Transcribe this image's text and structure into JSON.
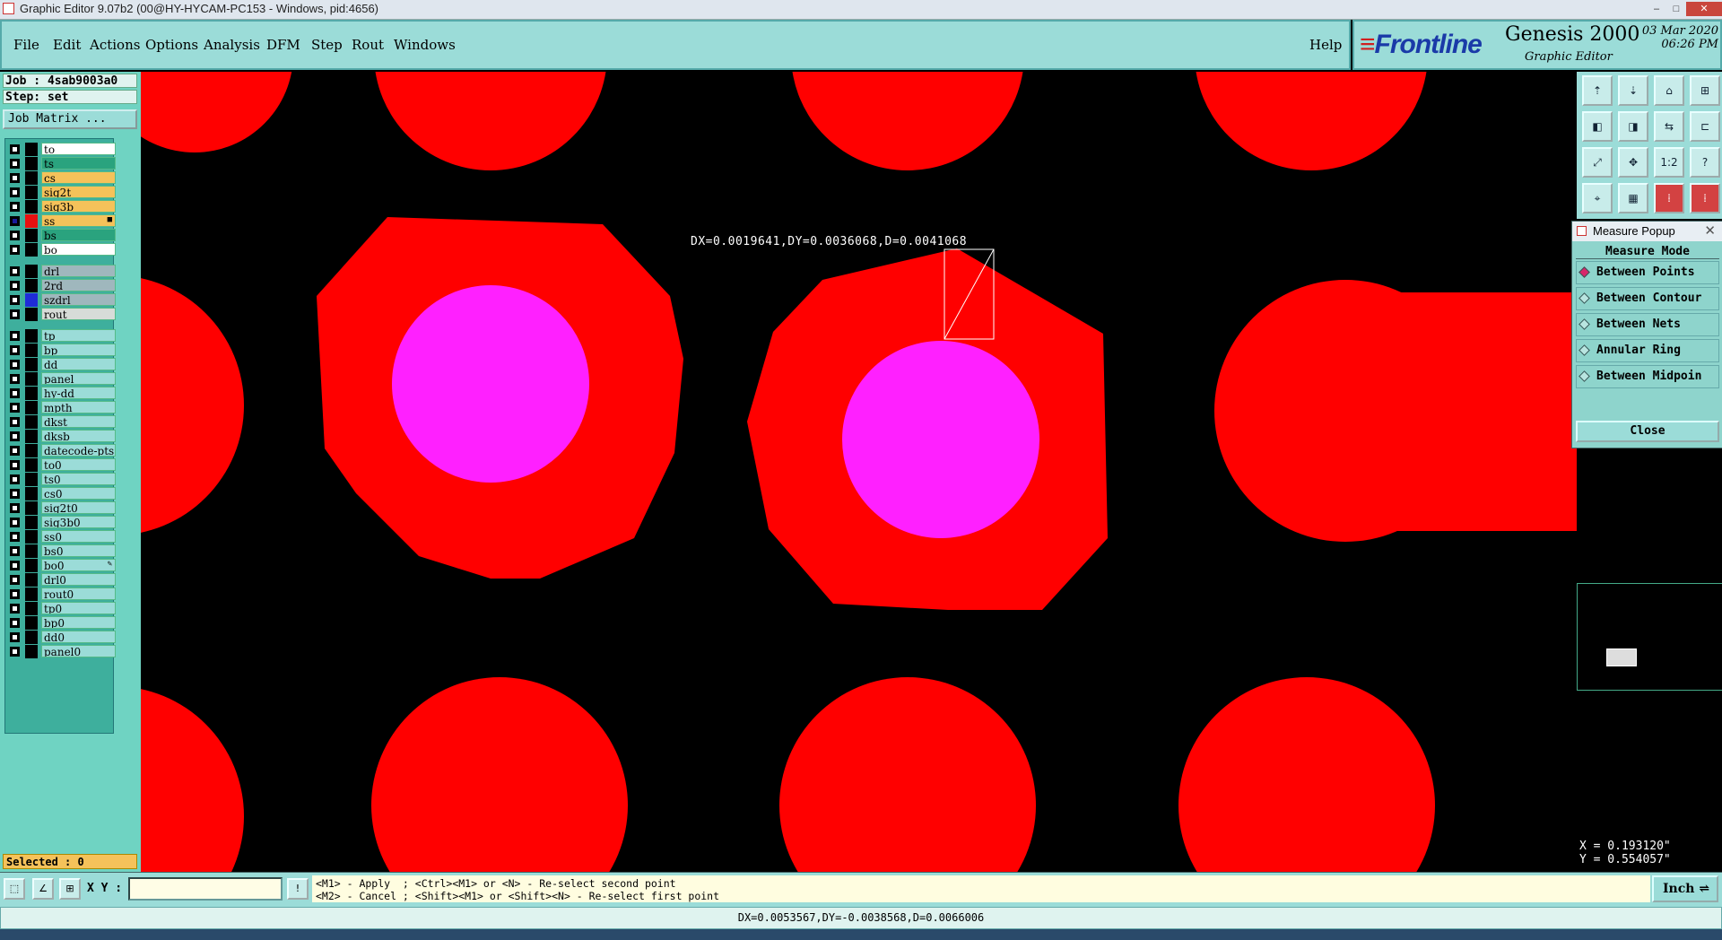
{
  "window": {
    "title": "Graphic Editor 9.07b2 (00@HY-HYCAM-PC153 - Windows, pid:4656)",
    "minimize": "–",
    "maximize": "□",
    "close": "✕"
  },
  "menu": {
    "items": [
      "File",
      "Edit",
      "Actions",
      "Options",
      "Analysis",
      "DFM",
      "Step",
      "Rout",
      "Windows"
    ],
    "help": "Help"
  },
  "brand": {
    "logo": "Frontline",
    "product": "Genesis 2000",
    "subtitle": "Graphic Editor",
    "date": "03 Mar 2020",
    "time": "06:26 PM"
  },
  "left_panel": {
    "job": "Job : 4sab9003a0",
    "step": "Step: set",
    "job_matrix": "Job Matrix ...",
    "selected": "Selected : 0",
    "layers": [
      {
        "name": "to",
        "color": "#ffffff",
        "swatch": "",
        "checked": false
      },
      {
        "name": "ts",
        "color": "#2aa37e",
        "swatch": "",
        "checked": false
      },
      {
        "name": "cs",
        "color": "#f5c25a",
        "swatch": "",
        "checked": false
      },
      {
        "name": "sig2t",
        "color": "#f5c25a",
        "swatch": "",
        "checked": false
      },
      {
        "name": "sig3b",
        "color": "#f5c25a",
        "swatch": "",
        "checked": false
      },
      {
        "name": "ss",
        "color": "#f5c25a",
        "swatch": "#e81010",
        "checked": true,
        "marker": "■"
      },
      {
        "name": "bs",
        "color": "#2aa37e",
        "swatch": "",
        "checked": false
      },
      {
        "name": "bo",
        "color": "#ffffff",
        "swatch": "",
        "checked": false
      },
      {
        "name": "drl",
        "color": "#9fb7bd",
        "swatch": "",
        "checked": false,
        "gap": true
      },
      {
        "name": "2rd",
        "color": "#9fb7bd",
        "swatch": "",
        "checked": false
      },
      {
        "name": "szdrl",
        "color": "#9fb7bd",
        "swatch": "#1f2bd8",
        "checked": false
      },
      {
        "name": "rout",
        "color": "#d7dcd8",
        "swatch": "",
        "checked": false
      },
      {
        "name": "tp",
        "color": "#9bdcd8",
        "swatch": "",
        "checked": false,
        "gap": true
      },
      {
        "name": "bp",
        "color": "#9bdcd8",
        "swatch": "",
        "checked": false
      },
      {
        "name": "dd",
        "color": "#9bdcd8",
        "swatch": "",
        "checked": false
      },
      {
        "name": "panel",
        "color": "#9bdcd8",
        "swatch": "",
        "checked": false
      },
      {
        "name": "hy-dd",
        "color": "#9bdcd8",
        "swatch": "",
        "checked": false
      },
      {
        "name": "mpth",
        "color": "#9bdcd8",
        "swatch": "",
        "checked": false
      },
      {
        "name": "dkst",
        "color": "#9bdcd8",
        "swatch": "",
        "checked": false
      },
      {
        "name": "dksb",
        "color": "#9bdcd8",
        "swatch": "",
        "checked": false
      },
      {
        "name": "datecode-pts",
        "color": "#9bdcd8",
        "swatch": "",
        "checked": false
      },
      {
        "name": "to0",
        "color": "#9bdcd8",
        "swatch": "",
        "checked": false
      },
      {
        "name": "ts0",
        "color": "#9bdcd8",
        "swatch": "",
        "checked": false
      },
      {
        "name": "cs0",
        "color": "#9bdcd8",
        "swatch": "",
        "checked": false
      },
      {
        "name": "sig2t0",
        "color": "#9bdcd8",
        "swatch": "",
        "checked": false
      },
      {
        "name": "sig3b0",
        "color": "#9bdcd8",
        "swatch": "",
        "checked": false
      },
      {
        "name": "ss0",
        "color": "#9bdcd8",
        "swatch": "",
        "checked": false
      },
      {
        "name": "bs0",
        "color": "#9bdcd8",
        "swatch": "",
        "checked": false
      },
      {
        "name": "bo0",
        "color": "#9bdcd8",
        "swatch": "",
        "checked": false,
        "marker": "✎"
      },
      {
        "name": "drl0",
        "color": "#9bdcd8",
        "swatch": "",
        "checked": false
      },
      {
        "name": "rout0",
        "color": "#9bdcd8",
        "swatch": "",
        "checked": false
      },
      {
        "name": "tp0",
        "color": "#9bdcd8",
        "swatch": "",
        "checked": false
      },
      {
        "name": "bp0",
        "color": "#9bdcd8",
        "swatch": "",
        "checked": false
      },
      {
        "name": "dd0",
        "color": "#9bdcd8",
        "swatch": "",
        "checked": false
      },
      {
        "name": "panel0",
        "color": "#9bdcd8",
        "swatch": "",
        "checked": false
      }
    ]
  },
  "canvas": {
    "pad_color": "#ff0000",
    "drill_color": "#ff20ff",
    "background": "#000000",
    "measure_text": "DX=0.0019641,DY=0.0036068,D=0.0041068"
  },
  "right_tools": {
    "buttons": [
      {
        "icon": "up-layer-icon",
        "glyph": "⇡",
        "red": false
      },
      {
        "icon": "down-layer-icon",
        "glyph": "⇣",
        "red": false
      },
      {
        "icon": "home-icon",
        "glyph": "⌂",
        "red": false
      },
      {
        "icon": "split-view-icon",
        "glyph": "⊞",
        "red": false
      },
      {
        "icon": "pan-left-icon",
        "glyph": "◧",
        "red": false
      },
      {
        "icon": "pan-right-icon",
        "glyph": "◨",
        "red": false
      },
      {
        "icon": "swap-icon",
        "glyph": "⇆",
        "red": false
      },
      {
        "icon": "snap-icon",
        "glyph": "⊏",
        "red": false
      },
      {
        "icon": "zoom-fit-icon",
        "glyph": "⤢",
        "red": false
      },
      {
        "icon": "zoom-center-icon",
        "glyph": "✥",
        "red": false
      },
      {
        "icon": "scale-icon",
        "glyph": "1:2",
        "red": false
      },
      {
        "icon": "help-icon",
        "glyph": "?",
        "red": false
      },
      {
        "icon": "measure-tool-icon",
        "glyph": "⌖",
        "red": false
      },
      {
        "icon": "grid-icon",
        "glyph": "▦",
        "red": false
      },
      {
        "icon": "feature-on-icon",
        "glyph": "⁞",
        "red": true
      },
      {
        "icon": "feature-off-icon",
        "glyph": "⁞",
        "red": true
      }
    ]
  },
  "measure_popup": {
    "title": "Measure Popup",
    "mode_label": "Measure Mode",
    "options": [
      {
        "label": "Between Points",
        "selected": true
      },
      {
        "label": "Between Contour",
        "selected": false
      },
      {
        "label": "Between Nets",
        "selected": false
      },
      {
        "label": "Annular Ring",
        "selected": false
      },
      {
        "label": "Between Midpoin",
        "selected": false
      }
    ],
    "close_label": "Close"
  },
  "coords": {
    "x": "X = 0.193120\"",
    "y": "Y = 0.554057\""
  },
  "bottom": {
    "xy_label": "X Y :",
    "xy_value": "",
    "hint_line1": "<M1> - Apply  ; <Ctrl><M1> or <N> - Re-select second point",
    "hint_line2": "<M2> - Cancel ; <Shift><M1> or <Shift><N> - Re-select first point",
    "unit": "Inch",
    "status": "DX=0.0053567,DY=-0.0038568,D=0.0066006"
  }
}
